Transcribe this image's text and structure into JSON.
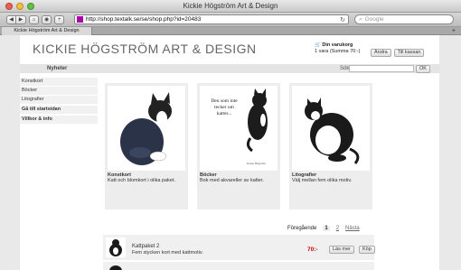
{
  "window": {
    "title": "Kickie Högström Art & Design"
  },
  "browser": {
    "url": "http://shop.textalk.se/se/shop.php?id=20483",
    "search_placeholder": "Google",
    "tab_label": "Kickie Högström Art & Design"
  },
  "site": {
    "title": "KICKIE HÖGSTRÖM ART & DESIGN",
    "cart": {
      "title": "Din varukorg",
      "summary": "1 vara (Summa 70:-)",
      "change_label": "Ändra",
      "checkout_label": "Till kassan"
    },
    "nav": {
      "active_label": "Nyheter"
    },
    "search": {
      "label": "Sök:",
      "ok_label": "OK"
    },
    "sidebar": [
      {
        "label": "Konstkort",
        "bold": false
      },
      {
        "label": "Böcker",
        "bold": false
      },
      {
        "label": "Litografier",
        "bold": false
      },
      {
        "label": "Gå till startsidan",
        "bold": true
      },
      {
        "label": "Villkor & info",
        "bold": true
      }
    ],
    "products": [
      {
        "name": "Konstkort",
        "desc": "Katt och blomkort i olika paket."
      },
      {
        "name": "Böcker",
        "desc": "Bok med akvareller av katter.",
        "book_text": "Den som inte tecker om katter...",
        "book_author": "Kickie Högström"
      },
      {
        "name": "Litografier",
        "desc": "Välj mellan fem olika motiv."
      }
    ],
    "pagination": {
      "prev_label": "Föregående",
      "pages": [
        "1",
        "2"
      ],
      "next_label": "Nästa"
    },
    "package": {
      "name": "Kattpaket 2",
      "desc": "Fem stycken kort med kattmotiv.",
      "price": "70:-",
      "more_label": "Läs mer",
      "buy_label": "Köp"
    }
  }
}
